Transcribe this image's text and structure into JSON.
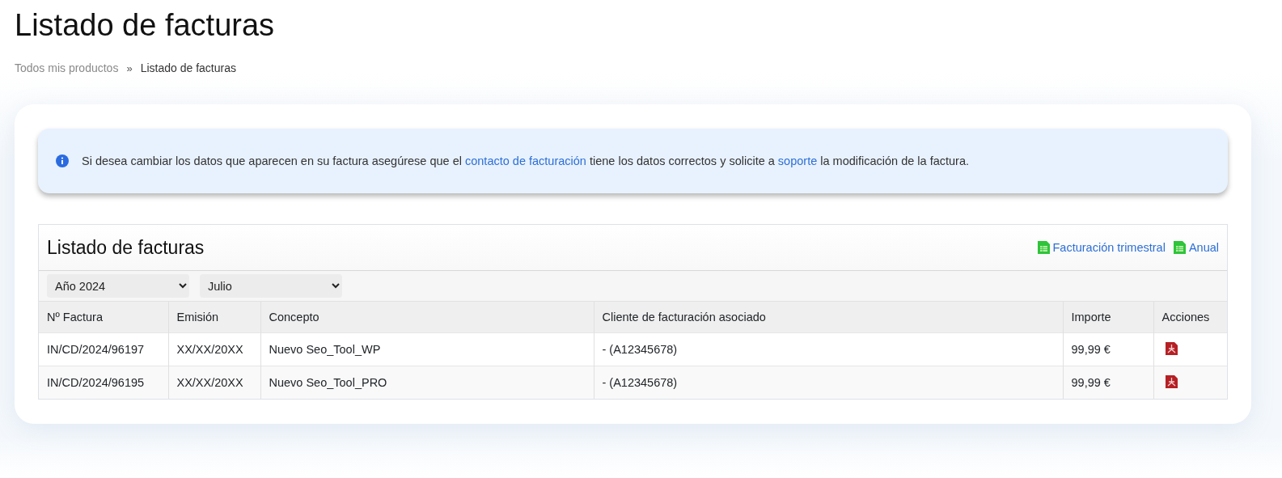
{
  "page_title": "Listado de facturas",
  "breadcrumb": [
    {
      "label": "Todos mis productos",
      "current": false
    },
    {
      "label": "Listado de facturas",
      "current": true
    }
  ],
  "breadcrumb_separator": "»",
  "alert": {
    "segments": [
      {
        "kind": "text",
        "text": "Si desea cambiar los datos que aparecen en su factura asegúrese que el "
      },
      {
        "kind": "link",
        "text": "contacto de facturación"
      },
      {
        "kind": "text",
        "text": " tiene los datos correctos y solicite a "
      },
      {
        "kind": "link",
        "text": "soporte"
      },
      {
        "kind": "text",
        "text": " la modificación de la factura."
      }
    ]
  },
  "panel": {
    "title": "Listado de facturas",
    "exports": [
      "Facturación trimestral",
      "Anual"
    ],
    "filters": [
      {
        "value": "Año 2024"
      },
      {
        "value": "Julio"
      }
    ],
    "table": {
      "columns": [
        "Nº Factura",
        "Emisión",
        "Concepto",
        "Cliente de facturación asociado",
        "Importe",
        "Acciones"
      ],
      "rows": [
        {
          "cells": [
            "IN/CD/2024/96197",
            "XX/XX/20XX",
            "Nuevo Seo_Tool_WP",
            "- (A12345678)",
            "99,99 €"
          ]
        },
        {
          "cells": [
            "IN/CD/2024/96195",
            "XX/XX/20XX",
            "Nuevo Seo_Tool_PRO",
            "- (A12345678)",
            "99,99 €"
          ]
        }
      ]
    }
  }
}
